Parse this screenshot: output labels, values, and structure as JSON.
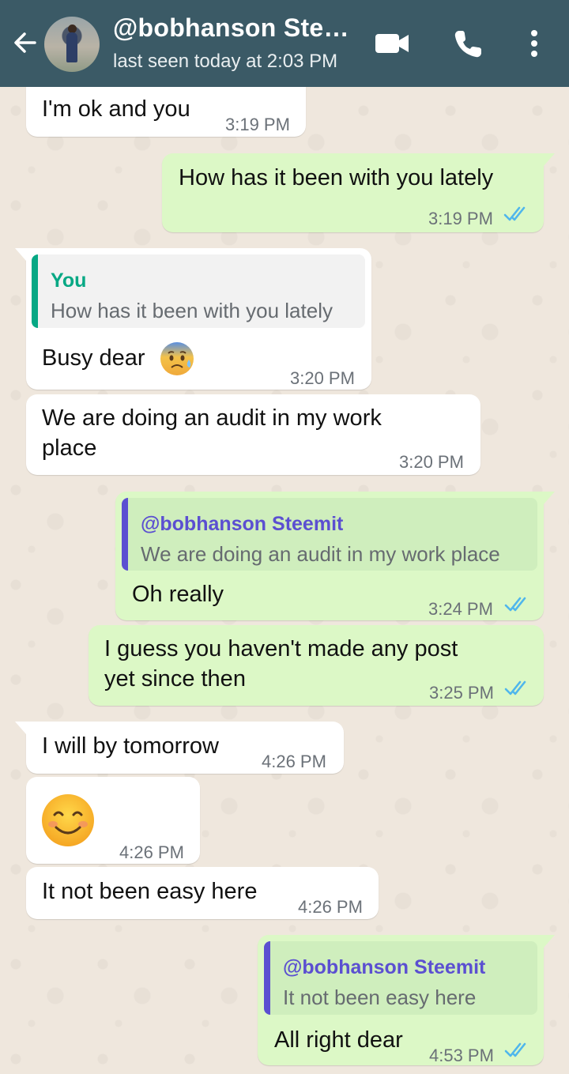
{
  "header": {
    "contact_name": "@bobhanson Ste…",
    "status": "last seen today at 2:03 PM",
    "bg_color": "#3b5a66"
  },
  "icons": {
    "back": "arrow-left-icon",
    "video": "video-camera-icon",
    "call": "phone-icon",
    "menu": "more-vertical-icon"
  },
  "colors": {
    "incoming_bubble": "#ffffff",
    "outgoing_bubble": "#dcf8c6",
    "read_ticks": "#4fb6ec",
    "quote_you": "#06a884",
    "quote_contact": "#5b4fd1"
  },
  "messages": [
    {
      "text": "I'm ok and you",
      "time": "3:19 PM",
      "direction": "in"
    },
    {
      "text": "How has it been with you lately",
      "time": "3:19 PM",
      "direction": "out",
      "read": true
    },
    {
      "quote_author": "You",
      "quote_text": "How has it been with you lately",
      "text": "Busy dear",
      "emoji": "anxious-face-with-sweat-icon",
      "time": "3:20 PM",
      "direction": "in"
    },
    {
      "line1": "We are doing an audit in my work",
      "line2": "place",
      "time": "3:20 PM",
      "direction": "in"
    },
    {
      "quote_author": "@bobhanson Steemit",
      "quote_text": "We are doing an audit in my work place",
      "text": "Oh really",
      "time": "3:24 PM",
      "direction": "out",
      "read": true
    },
    {
      "line1": "I guess you haven't made any post",
      "line2": "yet since then",
      "time": "3:25 PM",
      "direction": "out",
      "read": true
    },
    {
      "text": "I will by tomorrow",
      "time": "4:26 PM",
      "direction": "in"
    },
    {
      "emoji": "smiling-face-icon",
      "time": "4:26 PM",
      "direction": "in"
    },
    {
      "text": "It not been easy here",
      "time": "4:26 PM",
      "direction": "in"
    },
    {
      "quote_author": "@bobhanson Steemit",
      "quote_text": "It not been easy here",
      "text": "All right dear",
      "time": "4:53 PM",
      "direction": "out",
      "read": true
    }
  ]
}
